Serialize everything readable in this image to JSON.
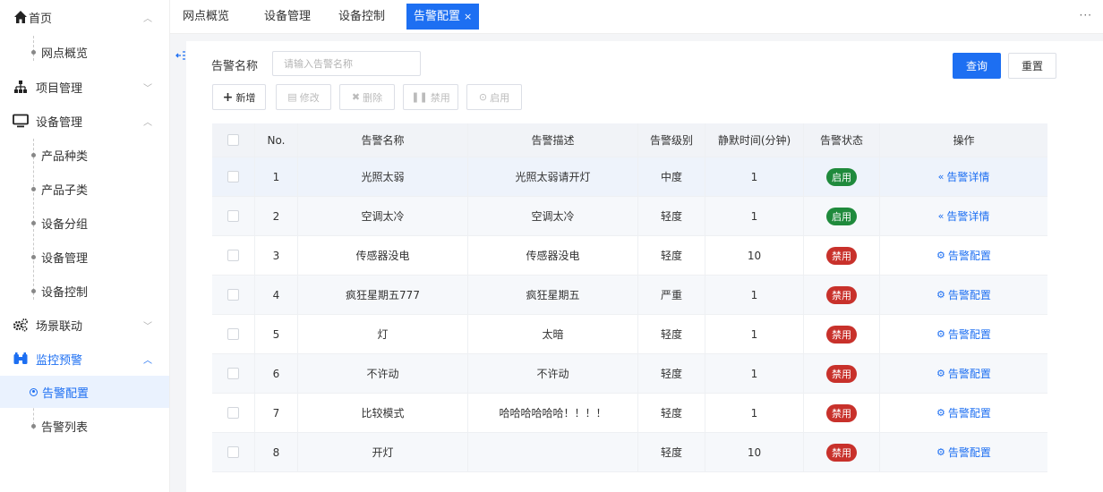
{
  "sidebar": {
    "items": [
      {
        "label": "首页",
        "icon": "home-icon",
        "chevron": "^"
      },
      {
        "label": "网点概览"
      },
      {
        "label": "项目管理",
        "icon": "hierarchy-icon",
        "chevron": "v"
      },
      {
        "label": "设备管理",
        "icon": "monitor-icon",
        "chevron": "^"
      },
      {
        "label": "产品种类"
      },
      {
        "label": "产品子类"
      },
      {
        "label": "设备分组"
      },
      {
        "label": "设备管理"
      },
      {
        "label": "设备控制"
      },
      {
        "label": "场景联动",
        "icon": "gears-icon",
        "chevron": "v"
      },
      {
        "label": "监控预警",
        "icon": "binoculars-icon",
        "chevron": "^"
      },
      {
        "label": "告警配置"
      },
      {
        "label": "告警列表"
      }
    ]
  },
  "tabs": [
    {
      "label": "网点概览"
    },
    {
      "label": "设备管理"
    },
    {
      "label": "设备控制"
    },
    {
      "label": "告警配置",
      "close": "×"
    }
  ],
  "more_label": "···",
  "search": {
    "label": "告警名称",
    "placeholder": "请输入告警名称",
    "query_label": "查询",
    "reset_label": "重置"
  },
  "toolbar": {
    "add_label": "新增",
    "edit_label": "修改",
    "delete_label": "删除",
    "disable_label": "禁用",
    "enable_label": "启用"
  },
  "table": {
    "headers": [
      "No.",
      "告警名称",
      "告警描述",
      "告警级别",
      "静默时间(分钟)",
      "告警状态",
      "操作"
    ],
    "rows": [
      {
        "no": "1",
        "name": "光照太弱",
        "desc": "光照太弱请开灯",
        "level": "中度",
        "silence": "1",
        "status": "启用",
        "status_kind": "on",
        "op": "告警详情",
        "op_icon": "«"
      },
      {
        "no": "2",
        "name": "空调太冷",
        "desc": "空调太冷",
        "level": "轻度",
        "silence": "1",
        "status": "启用",
        "status_kind": "on",
        "op": "告警详情",
        "op_icon": "«"
      },
      {
        "no": "3",
        "name": "传感器没电",
        "desc": "传感器没电",
        "level": "轻度",
        "silence": "10",
        "status": "禁用",
        "status_kind": "off",
        "op": "告警配置",
        "op_icon": "⚙"
      },
      {
        "no": "4",
        "name": "疯狂星期五777",
        "desc": "疯狂星期五",
        "level": "严重",
        "silence": "1",
        "status": "禁用",
        "status_kind": "off",
        "op": "告警配置",
        "op_icon": "⚙"
      },
      {
        "no": "5",
        "name": "灯",
        "desc": "太暗",
        "level": "轻度",
        "silence": "1",
        "status": "禁用",
        "status_kind": "off",
        "op": "告警配置",
        "op_icon": "⚙"
      },
      {
        "no": "6",
        "name": "不许动",
        "desc": "不许动",
        "level": "轻度",
        "silence": "1",
        "status": "禁用",
        "status_kind": "off",
        "op": "告警配置",
        "op_icon": "⚙"
      },
      {
        "no": "7",
        "name": "比较模式",
        "desc": "哈哈哈哈哈哈！！！！",
        "level": "轻度",
        "silence": "1",
        "status": "禁用",
        "status_kind": "off",
        "op": "告警配置",
        "op_icon": "⚙"
      },
      {
        "no": "8",
        "name": "开灯",
        "desc": "",
        "level": "轻度",
        "silence": "10",
        "status": "禁用",
        "status_kind": "off",
        "op": "告警配置",
        "op_icon": "⚙"
      }
    ]
  },
  "colors": {
    "accent": "#1d6ff2",
    "enabled": "#1f8a3c",
    "disabled": "#c8312b"
  }
}
